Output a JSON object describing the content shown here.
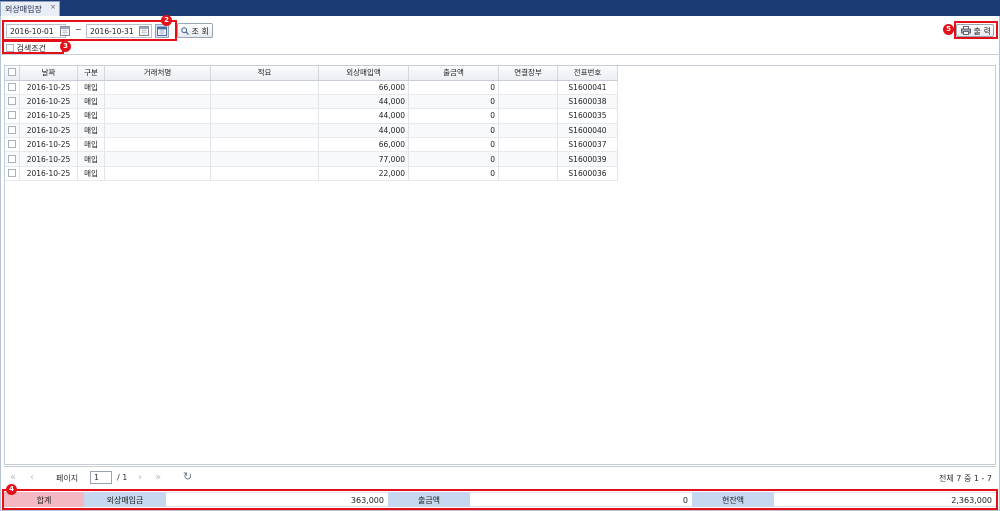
{
  "tab": {
    "title": "외상매입장",
    "close": "×"
  },
  "search": {
    "date_from": "2016-10-01",
    "tilde": "~",
    "date_to": "2016-10-31",
    "search_label": "조 회",
    "condition_label": "검색조건"
  },
  "toolbar": {
    "print_label": "출 력"
  },
  "badges": {
    "b2": "2",
    "b3": "3",
    "b4": "4",
    "b5": "5"
  },
  "table": {
    "headers": [
      "날짜",
      "구분",
      "거래처명",
      "적요",
      "외상매입액",
      "출금액",
      "연결장부",
      "전표번호"
    ],
    "rows": [
      [
        "2016-10-25",
        "매입",
        "",
        "",
        "66,000",
        "0",
        "",
        "S1600041"
      ],
      [
        "2016-10-25",
        "매입",
        "",
        "",
        "44,000",
        "0",
        "",
        "S1600038"
      ],
      [
        "2016-10-25",
        "매입",
        "",
        "",
        "44,000",
        "0",
        "",
        "S1600035"
      ],
      [
        "2016-10-25",
        "매입",
        "",
        "",
        "44,000",
        "0",
        "",
        "S1600040"
      ],
      [
        "2016-10-25",
        "매입",
        "",
        "",
        "66,000",
        "0",
        "",
        "S1600037"
      ],
      [
        "2016-10-25",
        "매입",
        "",
        "",
        "77,000",
        "0",
        "",
        "S1600039"
      ],
      [
        "2016-10-25",
        "매입",
        "",
        "",
        "22,000",
        "0",
        "",
        "S1600036"
      ]
    ]
  },
  "pager": {
    "page_label": "페이지",
    "page_value": "1",
    "total_pages": "/ 1",
    "count_text": "전체 7 중 1 - 7"
  },
  "summary": {
    "total_label": "합계",
    "purchase_label": "외상매입금",
    "purchase_value": "363,000",
    "payment_label": "출금액",
    "payment_value": "0",
    "balance_label": "현잔액",
    "balance_value": "2,363,000"
  },
  "colors": {
    "highlight": "#e3101a",
    "topbar": "#1c3a73",
    "total_bg": "#f4b8c3",
    "label_bg": "#c5d8ef"
  }
}
